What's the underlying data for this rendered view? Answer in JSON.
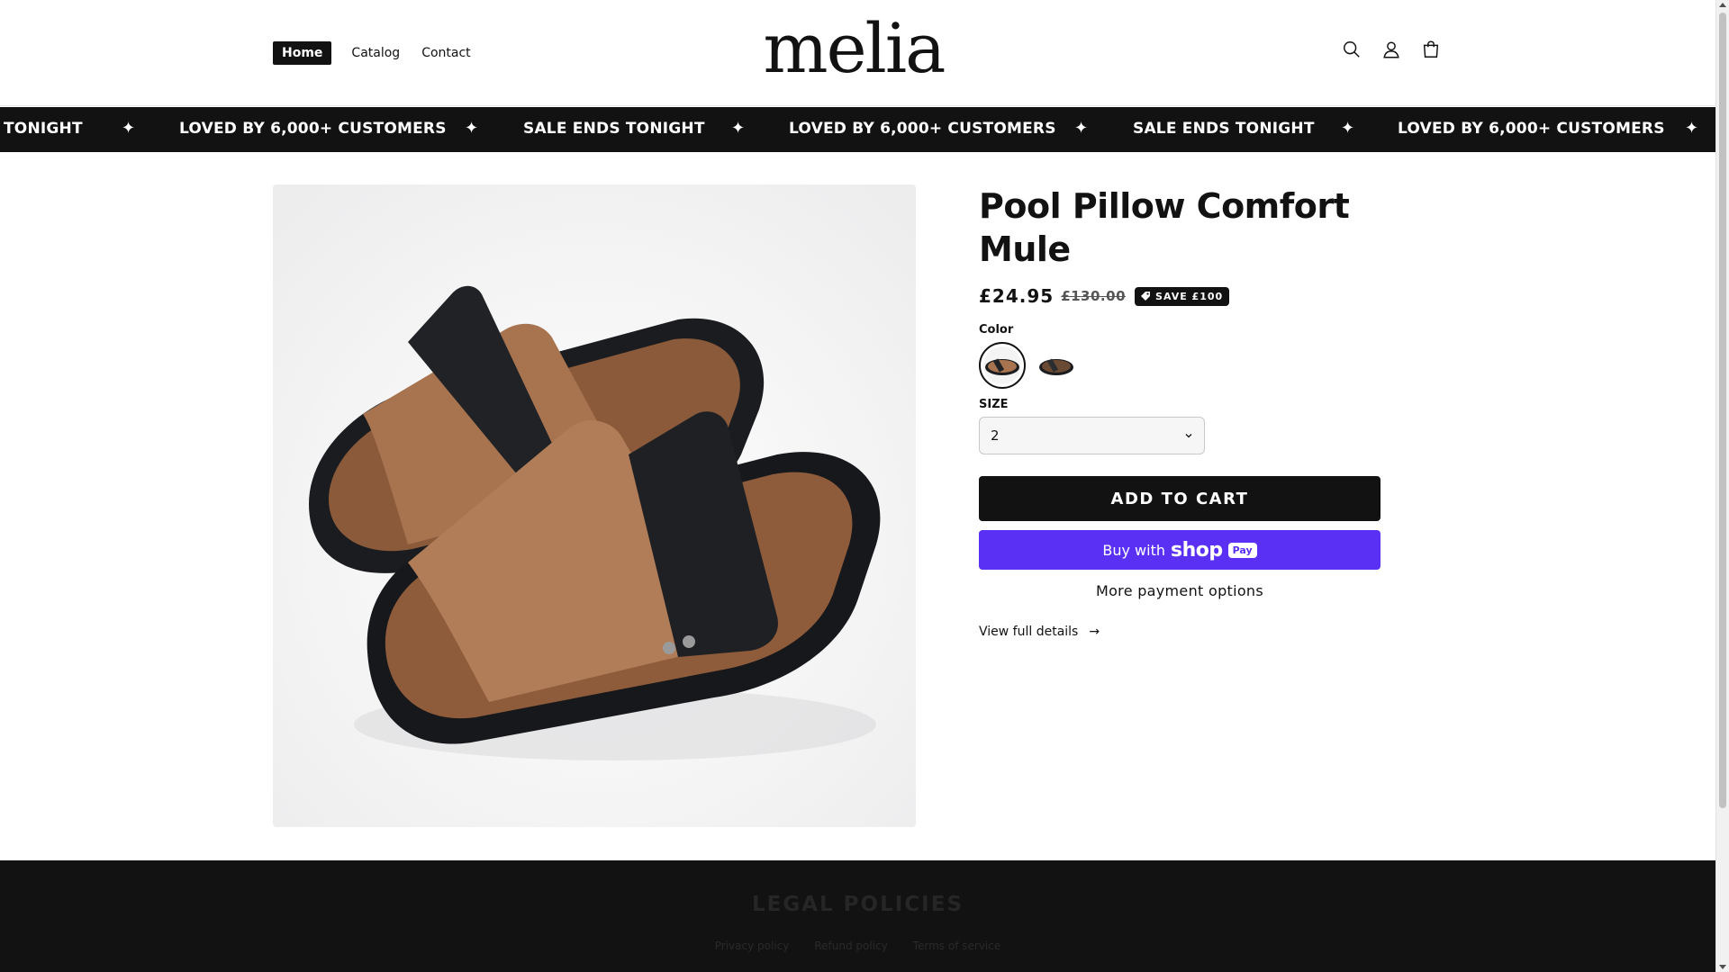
{
  "nav": {
    "home": "Home",
    "catalog": "Catalog",
    "contact": "Contact"
  },
  "brand": {
    "logo_text": "melia"
  },
  "header_icons": [
    "search-icon",
    "account-icon",
    "cart-icon"
  ],
  "announcement": {
    "items": [
      "TONIGHT",
      "LOVED BY 6,000+ CUSTOMERS",
      "SALE ENDS TONIGHT",
      "LOVED BY 6,000+ CUSTOMERS",
      "SALE ENDS TONIGHT",
      "LOVED BY 6,000+ CUSTOMERS"
    ],
    "separator": "✦"
  },
  "product": {
    "title": "Pool Pillow Comfort Mule",
    "price": "£24.95",
    "compare_price": "£130.00",
    "badge": "SAVE £100",
    "color_label": "Color",
    "size_label": "SIZE",
    "size_value": "2",
    "add_to_cart": "ADD TO CART",
    "buy_with": "Buy with",
    "shop_word": "shop",
    "pay_word": "Pay",
    "more_payment": "More payment options",
    "view_details": "View full details",
    "view_details_arrow": "→"
  },
  "footer": {
    "title": "LEGAL POLICIES",
    "links": [
      "Privacy policy",
      "Refund policy",
      "Terms of service"
    ]
  },
  "colors": {
    "primary": "#121212",
    "shop_pay": "#5a31f4",
    "accent_tan": "#b07d58"
  }
}
